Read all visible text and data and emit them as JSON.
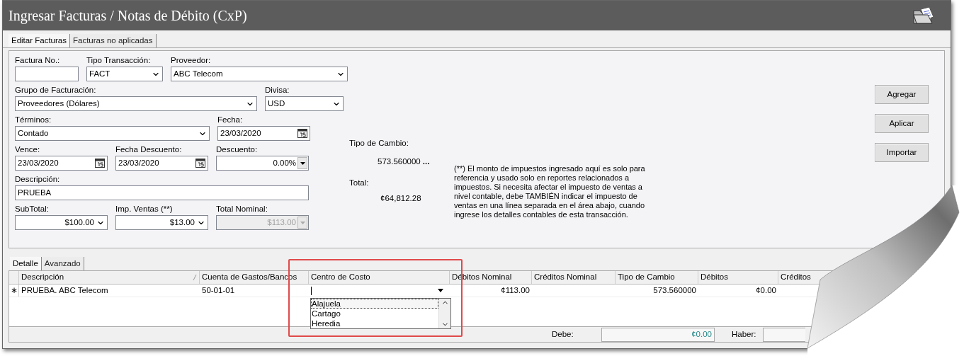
{
  "window": {
    "title": "Ingresar Facturas / Notas de Débito (CxP)"
  },
  "tabs": [
    {
      "label": "Editar Facturas",
      "selected": true
    },
    {
      "label": "Facturas no aplicadas",
      "selected": false
    }
  ],
  "fields": [
    {
      "label": "Factura No.:",
      "kind": "text"
    },
    {
      "label": "Tipo Transacción:",
      "kind": "combo",
      "value": "FACT"
    },
    {
      "label": "Proveedor:",
      "kind": "combo",
      "value": "ABC Telecom"
    },
    {
      "label": "Grupo de Facturación:",
      "kind": "combo",
      "value": "Proveedores (Dólares)"
    },
    {
      "label": "Divisa:",
      "kind": "combo",
      "value": "USD"
    },
    {
      "label": "Términos:",
      "kind": "combo",
      "value": "Contado"
    },
    {
      "label": "Fecha:",
      "kind": "date",
      "value": "23/03/2020"
    },
    {
      "label": "Vence:",
      "kind": "date",
      "value": "23/03/2020"
    },
    {
      "label": "Fecha Descuento:",
      "kind": "date",
      "value": "23/03/2020"
    },
    {
      "label": "Descuento:",
      "kind": "spin",
      "value": "0.00%",
      "disabled": false
    },
    {
      "label": "Descripción:",
      "kind": "text",
      "value": "PRUEBA"
    },
    {
      "label": "SubTotal:",
      "kind": "combo-right",
      "value": "$100.00"
    },
    {
      "label": "Imp. Ventas (**)",
      "kind": "combo-right",
      "value": "$13.00"
    },
    {
      "label": "Total Nominal:",
      "kind": "spin",
      "value": "$113.00",
      "disabled": true
    }
  ],
  "exchange": {
    "label": "Tipo de Cambio:",
    "value": "573.560000",
    "more": "..."
  },
  "total": {
    "label": "Total:",
    "value": "¢64,812.28"
  },
  "note": "(**) El monto de impuestos ingresado aquí es solo para referencia y usado solo en reportes relacionados a impuestos. Si necesita afectar el impuesto de ventas a nivel contable, debe TAMBIÉN indicar el impuesto de ventas en una línea separada en el área abajo, cuando ingrese los detalles contables de esta transacción.",
  "buttons": [
    "Agregar",
    "Aplicar",
    "Importar"
  ],
  "detail_tabs": [
    {
      "label": "Detalle",
      "selected": true
    },
    {
      "label": "Avanzado",
      "selected": false
    }
  ],
  "grid": {
    "columns": [
      {
        "label": "Descripción",
        "kind": "text",
        "sorted": true
      },
      {
        "label": "Cuenta de Gastos/Bancos",
        "kind": "text",
        "sorted": false
      },
      {
        "label": "Centro de Costo",
        "kind": "combo",
        "sorted": false
      },
      {
        "label": "Débitos Nominal",
        "kind": "number",
        "sorted": false
      },
      {
        "label": "Créditos Nominal",
        "kind": "number",
        "sorted": false
      },
      {
        "label": "Tipo de Cambio",
        "kind": "number",
        "sorted": false
      },
      {
        "label": "Débitos",
        "kind": "number",
        "sorted": false
      },
      {
        "label": "Créditos",
        "kind": "number",
        "sorted": false
      }
    ],
    "rows": [
      {
        "marker": "∗",
        "cells": [
          "PRUEBA. ABC Telecom",
          "50-01-01",
          null,
          "¢113.00",
          null,
          "573.560000",
          "¢0.00",
          null
        ]
      }
    ],
    "dropdown": {
      "items": [
        {
          "label": "Alajuela",
          "selected": true
        },
        {
          "label": "Cartago",
          "selected": false
        },
        {
          "label": "Heredia",
          "selected": false
        }
      ]
    }
  },
  "footer": {
    "debe_label": "Debe:",
    "debe_value": "¢0.00",
    "haber_label": "Haber:"
  }
}
